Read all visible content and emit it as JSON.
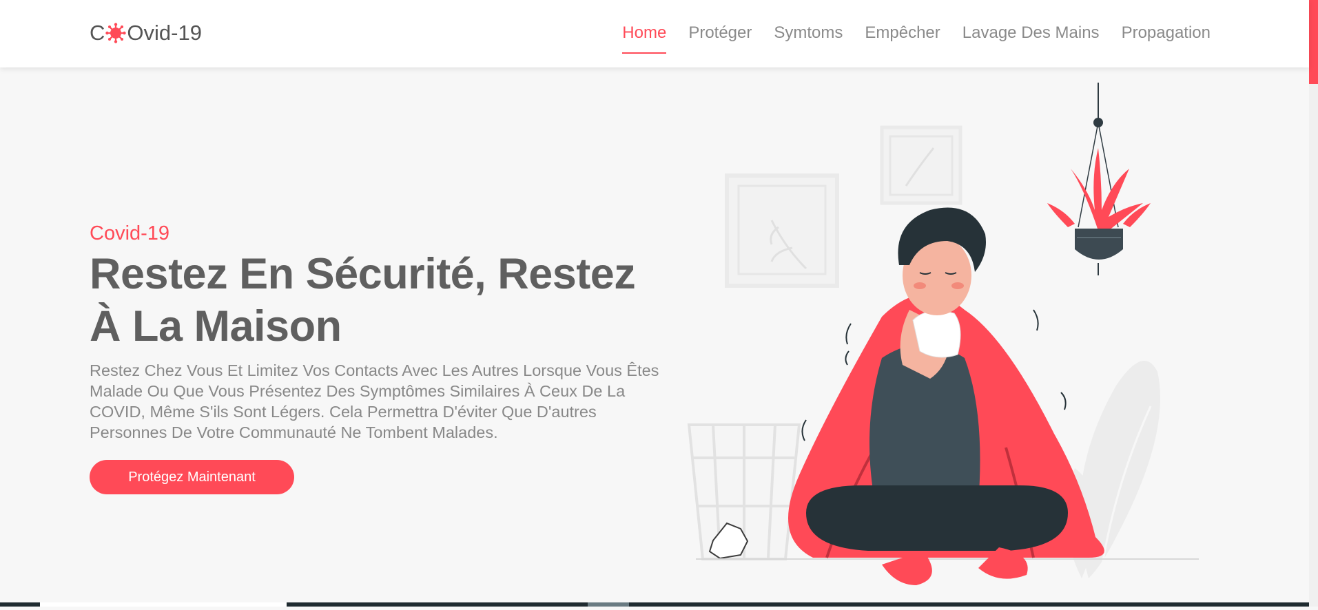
{
  "header": {
    "logo": {
      "prefix": "C",
      "suffix": "Ovid-19",
      "icon": "virus-icon"
    },
    "nav": [
      {
        "label": "Home",
        "active": true
      },
      {
        "label": "Protéger",
        "active": false
      },
      {
        "label": "Symtoms",
        "active": false
      },
      {
        "label": "Empêcher",
        "active": false
      },
      {
        "label": "Lavage Des Mains",
        "active": false
      },
      {
        "label": "Propagation",
        "active": false
      }
    ]
  },
  "hero": {
    "eyebrow": "Covid-19",
    "title": "Restez En Sécurité, Restez À La Maison",
    "description": "Restez Chez Vous Et Limitez Vos Contacts Avec Les Autres Lorsque Vous Êtes Malade Ou Que Vous Présentez Des Symptômes Similaires À Ceux De La COVID, Même S'ils Sont Légers. Cela Permettra D'éviter Que D'autres Personnes De Votre Communauté Ne Tombent Malades.",
    "cta_label": "Protégez Maintenant",
    "illustration": "sick-man-sneezing-illustration"
  },
  "colors": {
    "accent": "#ff4a57",
    "heading": "#5f5f5f",
    "text": "#888888",
    "background": "#f7f7f7"
  }
}
